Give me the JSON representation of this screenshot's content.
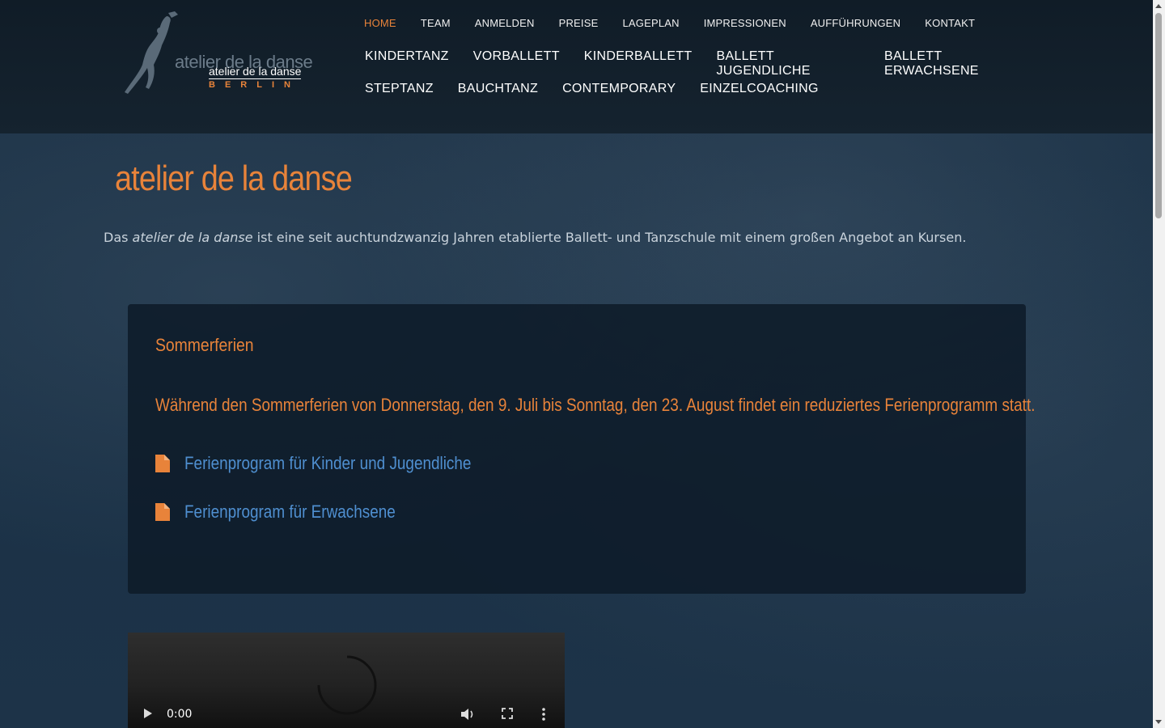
{
  "brand": {
    "logo_line1": "atelier de la danse",
    "logo_line2": "atelier de la danse",
    "logo_sub": "BERLIN",
    "accent_color": "#e8833a",
    "link_color": "#4f8fd0"
  },
  "topnav": [
    {
      "label": "HOME",
      "active": true
    },
    {
      "label": "TEAM"
    },
    {
      "label": "ANMELDEN"
    },
    {
      "label": "PREISE"
    },
    {
      "label": "LAGEPLAN"
    },
    {
      "label": "IMPRESSIONEN"
    },
    {
      "label": "AUFFÜHRUNGEN"
    },
    {
      "label": "KONTAKT"
    }
  ],
  "mainnav": {
    "row1": [
      "KINDERTANZ",
      "VORBALLETT",
      "KINDERBALLETT",
      "BALLETT JUGENDLICHE",
      "BALLETT ERWACHSENE"
    ],
    "row2": [
      "STEPTANZ",
      "BAUCHTANZ",
      "CONTEMPORARY",
      "EINZELCOACHING"
    ]
  },
  "page": {
    "title": "atelier de la danse",
    "intro_pre": "Das ",
    "intro_em": "atelier de la danse",
    "intro_post": " ist eine seit auchtundzwanzig Jahren etablierte Ballett- und Tanzschule mit einem großen Angebot an Kursen."
  },
  "notice_card": {
    "heading": "Sommerferien",
    "text": "Während den Sommerferien von Donnerstag, den 9. Juli bis Sonntag, den 23. August findet ein reduziertes Ferienprogramm statt.",
    "downloads": [
      {
        "icon": "file-icon",
        "label": "Ferienprogram für Kinder und Jugendliche"
      },
      {
        "icon": "file-icon",
        "label": "Ferienprogram für Erwachsene"
      }
    ]
  },
  "video": {
    "time": "0:00",
    "state": "loading"
  }
}
